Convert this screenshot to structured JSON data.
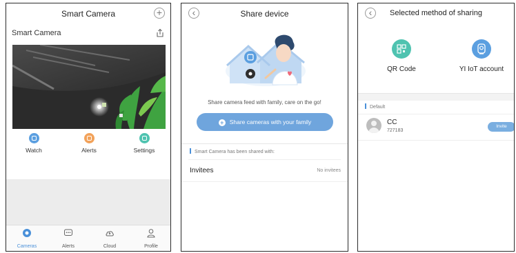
{
  "panel1": {
    "title": "Smart Camera",
    "camera_name": "Smart Camera",
    "actions": [
      {
        "label": "Watch",
        "color": "#5b9fe0"
      },
      {
        "label": "Alerts",
        "color": "#f2a25a"
      },
      {
        "label": "Settings",
        "color": "#4fc3b0"
      }
    ],
    "tabs": [
      {
        "label": "Cameras",
        "icon": "camera-icon",
        "active": true
      },
      {
        "label": "Alerts",
        "icon": "chat-icon",
        "active": false
      },
      {
        "label": "Cloud",
        "icon": "cloud-icon",
        "active": false
      },
      {
        "label": "Profile",
        "icon": "person-icon",
        "active": false
      }
    ]
  },
  "panel2": {
    "title": "Share device",
    "tagline": "Share camera feed with family, care on the go!",
    "share_button": "Share cameras with your family",
    "section_label": "Smart Camera has been shared with:",
    "invitees_label": "Invitees",
    "no_invitees": "No invitees"
  },
  "panel3": {
    "title": "Selected method of sharing",
    "methods": [
      {
        "label": "QR Code",
        "color": "#4fc3b0",
        "icon": "qr-code-icon"
      },
      {
        "label": "YI IoT account",
        "color": "#5b9fe0",
        "icon": "account-icon"
      }
    ],
    "default_label": "Default",
    "contact": {
      "name": "CC",
      "number": "727183",
      "invite_label": "Invite"
    }
  },
  "colors": {
    "accent": "#4a90d9",
    "button": "#6fa5dd"
  }
}
